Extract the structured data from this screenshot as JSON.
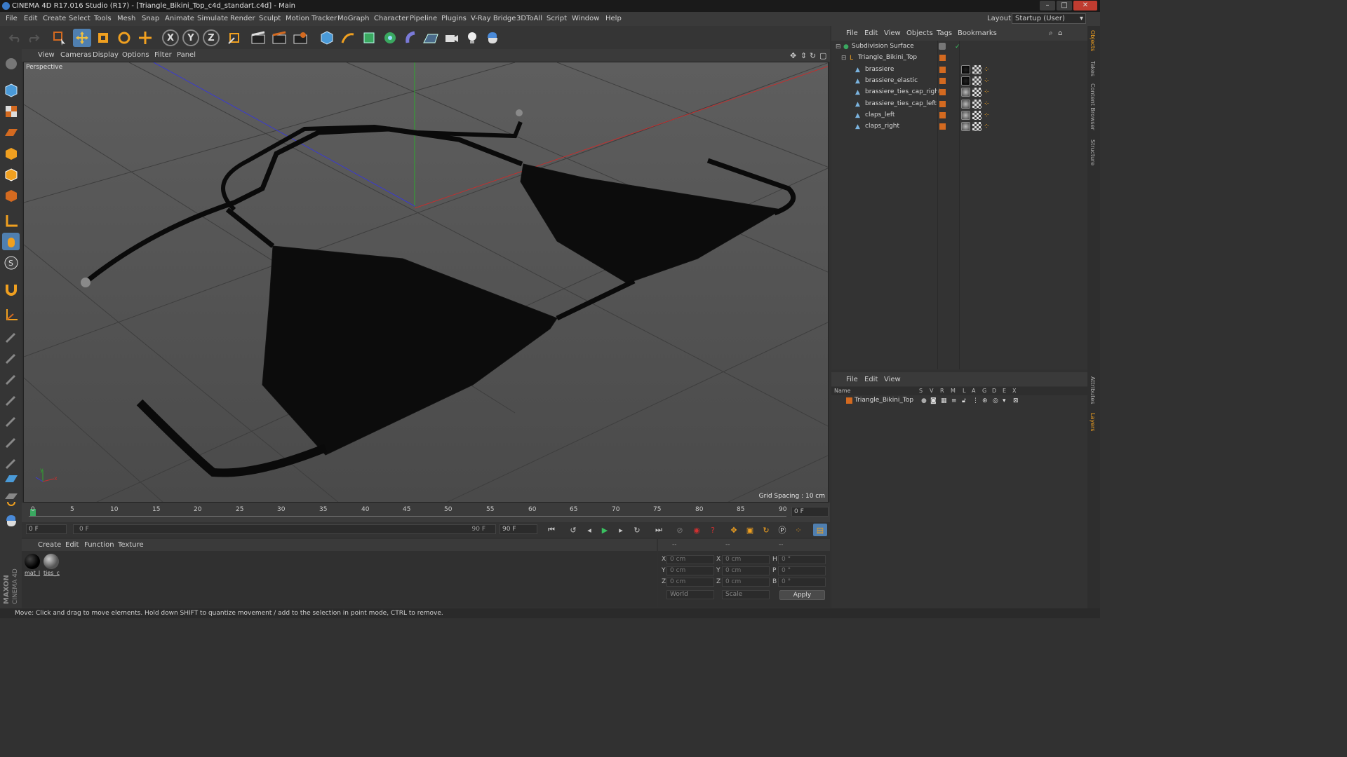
{
  "window": {
    "title": "CINEMA 4D R17.016 Studio (R17) - [Triangle_Bikini_Top_c4d_standart.c4d] - Main",
    "minimize": "–",
    "maximize": "□",
    "close": "✕"
  },
  "menubar": [
    "File",
    "Edit",
    "Create",
    "Select",
    "Tools",
    "Mesh",
    "Snap",
    "Animate",
    "Simulate",
    "Render",
    "Sculpt",
    "Motion Tracker",
    "MoGraph",
    "Character",
    "Pipeline",
    "Plugins",
    "V-Ray Bridge",
    "3DToAll",
    "Script",
    "Window",
    "Help"
  ],
  "layout": {
    "label": "Layout:",
    "value": "Startup (User)"
  },
  "toolbar": {
    "axis_x": "X",
    "axis_y": "Y",
    "axis_z": "Z"
  },
  "viewport": {
    "menu": [
      "View",
      "Cameras",
      "Display",
      "Options",
      "Filter",
      "Panel"
    ],
    "label": "Perspective",
    "grid_spacing": "Grid Spacing : 10 cm",
    "axis_y": "y",
    "axis_x": "x"
  },
  "timeline": {
    "ticks": [
      "0",
      "5",
      "10",
      "15",
      "20",
      "25",
      "30",
      "35",
      "40",
      "45",
      "50",
      "55",
      "60",
      "65",
      "70",
      "75",
      "80",
      "85",
      "90"
    ],
    "current_frame": "0 F"
  },
  "transport": {
    "start": "0 F",
    "range_start": "0 F",
    "range_end": "90 F",
    "end": "90 F"
  },
  "materials": {
    "menu": [
      "Create",
      "Edit",
      "Function",
      "Texture"
    ],
    "items": [
      {
        "label": "mat_l",
        "color": "#050505"
      },
      {
        "label": "ties_c",
        "color": "#5a5a5a"
      }
    ]
  },
  "coords": {
    "headers": [
      "--",
      "--",
      "--"
    ],
    "rows": [
      {
        "a": "X",
        "av": "0 cm",
        "b": "X",
        "bv": "0 cm",
        "c": "H",
        "cv": "0 °"
      },
      {
        "a": "Y",
        "av": "0 cm",
        "b": "Y",
        "bv": "0 cm",
        "c": "P",
        "cv": "0 °"
      },
      {
        "a": "Z",
        "av": "0 cm",
        "b": "Z",
        "bv": "0 cm",
        "c": "B",
        "cv": "0 °"
      }
    ],
    "mode1": "World",
    "mode2": "Scale",
    "apply": "Apply"
  },
  "objects": {
    "menu": [
      "File",
      "Edit",
      "View",
      "Objects",
      "Tags",
      "Bookmarks"
    ],
    "items": [
      {
        "name": "Subdivision Surface",
        "level": 0
      },
      {
        "name": "Triangle_Bikini_Top",
        "level": 1
      },
      {
        "name": "brassiere",
        "level": 2
      },
      {
        "name": "brassiere_elastic",
        "level": 2
      },
      {
        "name": "brassiere_ties_cap_right",
        "level": 2
      },
      {
        "name": "brassiere_ties_cap_left",
        "level": 2
      },
      {
        "name": "claps_left",
        "level": 2
      },
      {
        "name": "claps_right",
        "level": 2
      }
    ]
  },
  "layers": {
    "menu": [
      "File",
      "Edit",
      "View"
    ],
    "columns": [
      "Name",
      "S",
      "V",
      "R",
      "M",
      "L",
      "A",
      "G",
      "D",
      "E",
      "X"
    ],
    "rows": [
      {
        "name": "Triangle_Bikini_Top"
      }
    ]
  },
  "right_tabs": [
    "Objects",
    "Takes",
    "Content Browser",
    "Structure",
    "Attributes",
    "Layers"
  ],
  "branding": {
    "line1": "MAXON",
    "line2": "CINEMA 4D"
  },
  "status": "Move: Click and drag to move elements. Hold down SHIFT to quantize movement / add to the selection in point mode, CTRL to remove.",
  "colors": {
    "accent_orange": "#d46a20",
    "accent_blue": "#3a7ac8",
    "active_tool": "#4f7fb0"
  }
}
